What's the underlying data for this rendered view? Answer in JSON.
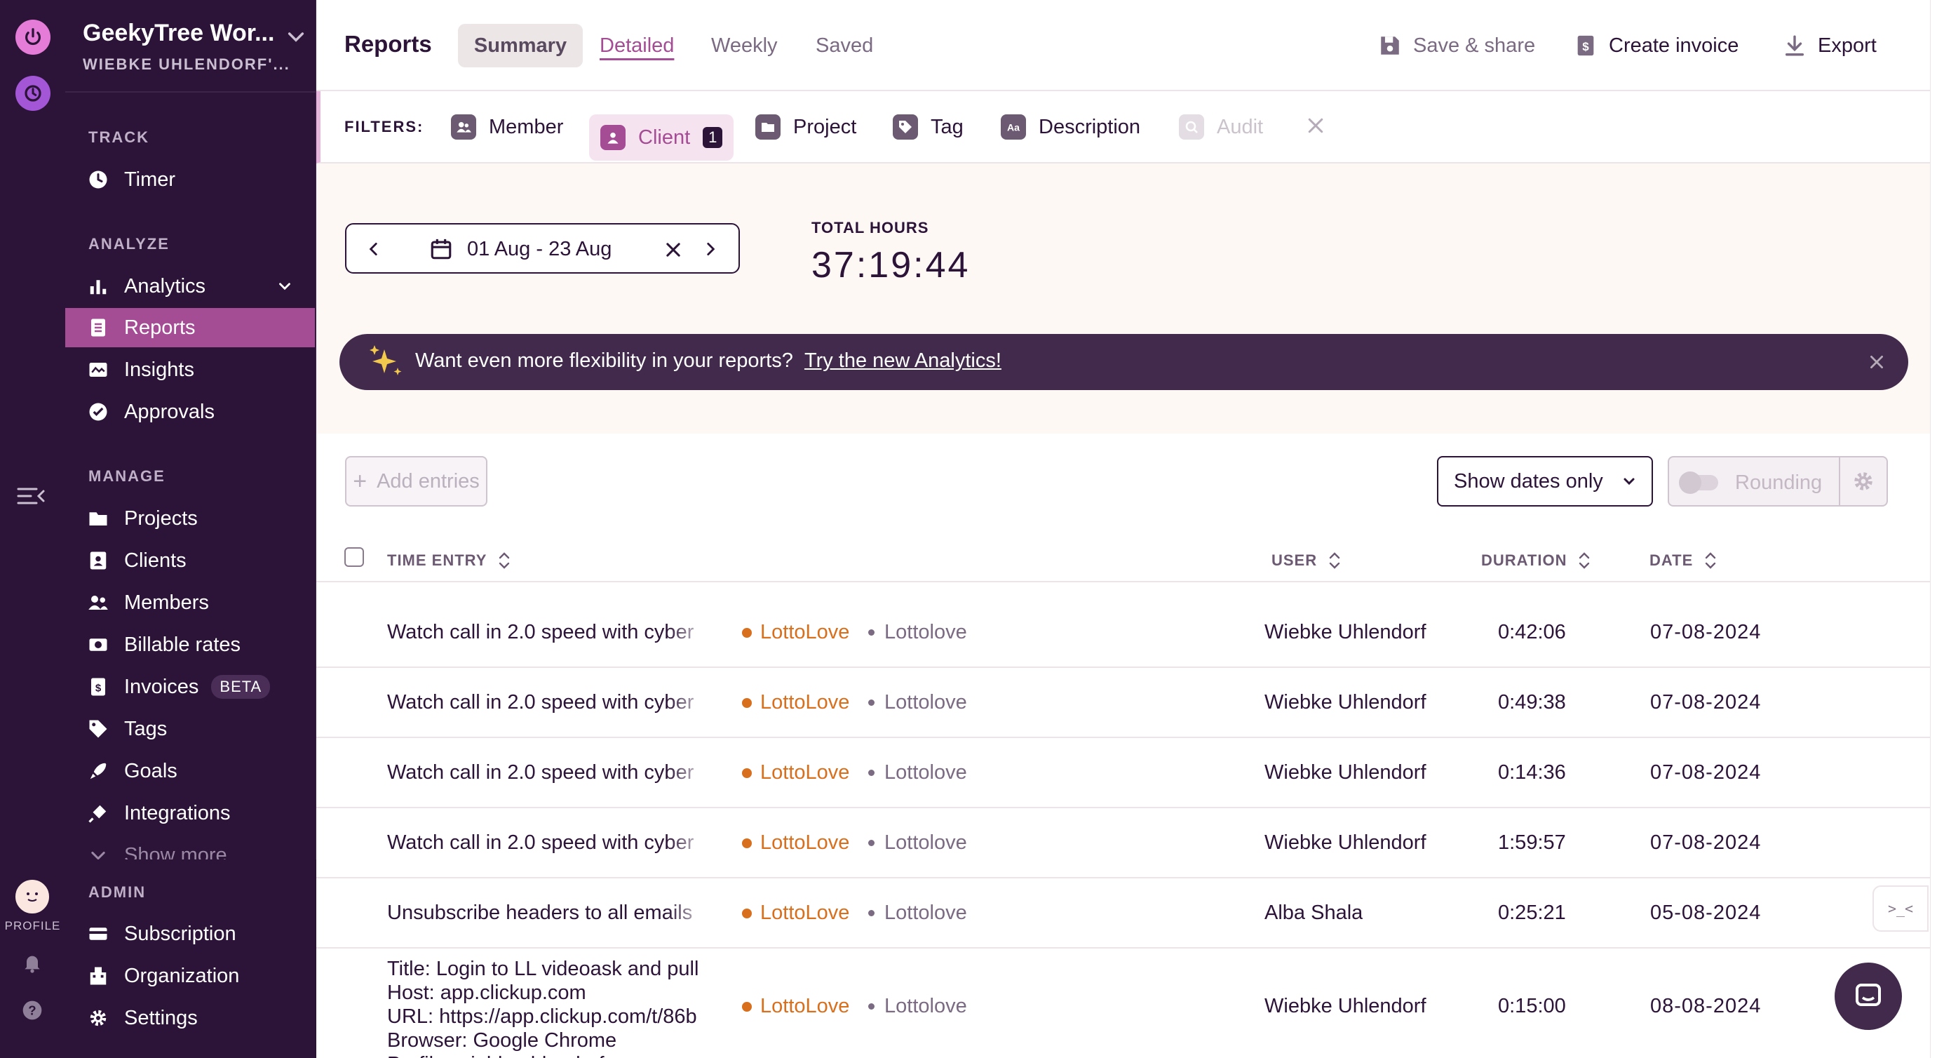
{
  "rail": {
    "profile_label": "PROFILE"
  },
  "workspace": {
    "name": "GeekyTree Wor...",
    "owner": "WIEBKE UHLENDORF'..."
  },
  "sidebar": {
    "sections": {
      "track": "TRACK",
      "analyze": "ANALYZE",
      "manage": "MANAGE",
      "admin": "ADMIN"
    },
    "items": {
      "timer": "Timer",
      "analytics": "Analytics",
      "reports": "Reports",
      "insights": "Insights",
      "approvals": "Approvals",
      "projects": "Projects",
      "clients": "Clients",
      "members": "Members",
      "billable_rates": "Billable rates",
      "invoices": "Invoices",
      "invoices_badge": "BETA",
      "tags": "Tags",
      "goals": "Goals",
      "integrations": "Integrations",
      "show_more": "Show more",
      "subscription": "Subscription",
      "organization": "Organization",
      "settings": "Settings"
    },
    "active_item": "reports"
  },
  "header": {
    "title": "Reports",
    "tabs": {
      "summary": "Summary",
      "detailed": "Detailed",
      "weekly": "Weekly",
      "saved": "Saved"
    },
    "active_tab": "detailed",
    "actions": {
      "save_share": "Save & share",
      "create_invoice": "Create invoice",
      "export": "Export"
    }
  },
  "filters": {
    "label": "FILTERS:",
    "member": "Member",
    "client": "Client",
    "client_count": "1",
    "project": "Project",
    "tag": "Tag",
    "description": "Description",
    "audit": "Audit"
  },
  "date_range": {
    "value": "01 Aug - 23 Aug"
  },
  "total": {
    "label": "TOTAL HOURS",
    "value": "37:19:44"
  },
  "banner": {
    "text": "Want even more flexibility in your reports?",
    "link": "Try the new Analytics!"
  },
  "toolbar": {
    "add_entries": "Add entries",
    "group_select": "Show dates only",
    "rounding": "Rounding"
  },
  "table": {
    "columns": {
      "entry": "TIME ENTRY",
      "user": "USER",
      "duration": "DURATION",
      "date": "DATE"
    },
    "rows": [
      {
        "description": "Watch call in 2.0 speed with cyber",
        "project": "LottoLove",
        "client": "Lottolove",
        "user": "Wiebke Uhlendorf",
        "duration": "0:42:06",
        "date": "07-08-2024"
      },
      {
        "description": "Watch call in 2.0 speed with cyber",
        "project": "LottoLove",
        "client": "Lottolove",
        "user": "Wiebke Uhlendorf",
        "duration": "0:49:38",
        "date": "07-08-2024"
      },
      {
        "description": "Watch call in 2.0 speed with cyber",
        "project": "LottoLove",
        "client": "Lottolove",
        "user": "Wiebke Uhlendorf",
        "duration": "0:14:36",
        "date": "07-08-2024"
      },
      {
        "description": "Watch call in 2.0 speed with cyber",
        "project": "LottoLove",
        "client": "Lottolove",
        "user": "Wiebke Uhlendorf",
        "duration": "1:59:57",
        "date": "07-08-2024"
      },
      {
        "description": "Unsubscribe headers to all emails",
        "project": "LottoLove",
        "client": "Lottolove",
        "user": "Alba Shala",
        "duration": "0:25:21",
        "date": "05-08-2024"
      },
      {
        "description_lines": [
          "Title: Login to LL videoask and pull",
          "Host: app.clickup.com",
          "URL: https://app.clickup.com/t/86b",
          "Browser: Google Chrome",
          "Profile: wiebkeuhlendorf.com"
        ],
        "project": "LottoLove",
        "client": "Lottolove",
        "user": "Wiebke Uhlendorf",
        "duration": "0:15:00",
        "date": "08-08-2024"
      }
    ]
  },
  "side_widget": {
    "label": ">_<"
  },
  "colors": {
    "sidebar_bg": "#2c1338",
    "accent": "#a44c94",
    "project": "#d86f1d"
  }
}
